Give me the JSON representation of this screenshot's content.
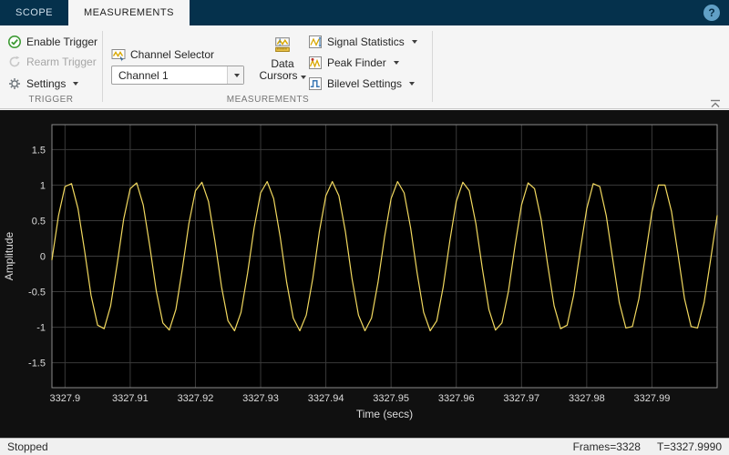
{
  "tabs": [
    {
      "label": "SCOPE",
      "active": false
    },
    {
      "label": "MEASUREMENTS",
      "active": true
    }
  ],
  "help": {
    "label": "?"
  },
  "icons": {
    "enable_trigger": "check-circle",
    "rearm_trigger": "rearm-arrow",
    "settings": "gear",
    "channel_selector": "signal-select",
    "data_cursors": "cursor-ruler",
    "signal_statistics": "statistics-chart",
    "peak_finder": "peak-marker",
    "bilevel_settings": "square-wave",
    "dropdown": "caret-down",
    "collapse_toolstrip": "chevron-up"
  },
  "toolbar": {
    "trigger": {
      "enable_label": "Enable Trigger",
      "rearm_label": "Rearm Trigger",
      "settings_label": "Settings",
      "section_label": "TRIGGER"
    },
    "measurements": {
      "channel_selector_label": "Channel Selector",
      "channel_value": "Channel 1",
      "data_cursors_label": "Data Cursors",
      "signal_statistics_label": "Signal Statistics",
      "peak_finder_label": "Peak Finder",
      "bilevel_settings_label": "Bilevel Settings",
      "section_label": "MEASUREMENTS"
    }
  },
  "status": {
    "left": "Stopped",
    "frames": "Frames=3328",
    "time": "T=3327.9990"
  },
  "chart_data": {
    "type": "line",
    "title": "",
    "xlabel": "Time (secs)",
    "ylabel": "Amplitude",
    "xlim": [
      3327.898,
      3328.0
    ],
    "ylim": [
      -1.85,
      1.85
    ],
    "xticks": [
      3327.9,
      3327.91,
      3327.92,
      3327.93,
      3327.94,
      3327.95,
      3327.96,
      3327.97,
      3327.98,
      3327.99
    ],
    "xtick_labels": [
      "3327.9",
      "3327.91",
      "3327.92",
      "3327.93",
      "3327.94",
      "3327.95",
      "3327.96",
      "3327.97",
      "3327.98",
      "3327.99"
    ],
    "yticks": [
      1.5,
      1,
      0.5,
      0,
      -0.5,
      -1,
      -1.5
    ],
    "ytick_labels": [
      "1.5",
      "1",
      "0.5",
      "0",
      "-0.5",
      "-1",
      "-1.5"
    ],
    "grid": true,
    "legend": false,
    "colors": {
      "line": "#f2d95f",
      "grid": "#3a3a3a",
      "axes_bg": "#000000",
      "frame": "#8a8a8a",
      "text": "#dcdcdc"
    },
    "series": [
      {
        "name": "Channel 1",
        "x_start": 3327.898,
        "x_step": 0.001,
        "values": [
          -0.05,
          0.57,
          0.98,
          1.02,
          0.67,
          0.08,
          -0.55,
          -0.97,
          -1.02,
          -0.7,
          -0.11,
          0.52,
          0.95,
          1.03,
          0.72,
          0.14,
          -0.49,
          -0.94,
          -1.04,
          -0.75,
          -0.18,
          0.46,
          0.92,
          1.04,
          0.77,
          0.21,
          -0.43,
          -0.91,
          -1.05,
          -0.79,
          -0.24,
          0.4,
          0.89,
          1.05,
          0.81,
          0.27,
          -0.37,
          -0.87,
          -1.05,
          -0.83,
          -0.31,
          0.34,
          0.85,
          1.05,
          0.85,
          0.34,
          -0.31,
          -0.83,
          -1.05,
          -0.87,
          -0.37,
          0.27,
          0.81,
          1.05,
          0.89,
          0.4,
          -0.24,
          -0.79,
          -1.05,
          -0.91,
          -0.43,
          0.21,
          0.77,
          1.04,
          0.92,
          0.46,
          -0.18,
          -0.75,
          -1.04,
          -0.94,
          -0.49,
          0.14,
          0.72,
          1.03,
          0.95,
          0.52,
          -0.11,
          -0.7,
          -1.02,
          -0.97,
          -0.55,
          0.08,
          0.67,
          1.02,
          0.98,
          0.57,
          -0.05,
          -0.65,
          -1.01,
          -0.99,
          -0.6,
          0.01,
          0.62,
          1.0,
          1.0,
          0.63,
          0.02,
          -0.6,
          -0.99,
          -1.01,
          -0.65,
          -0.05,
          0.57
        ]
      }
    ]
  }
}
